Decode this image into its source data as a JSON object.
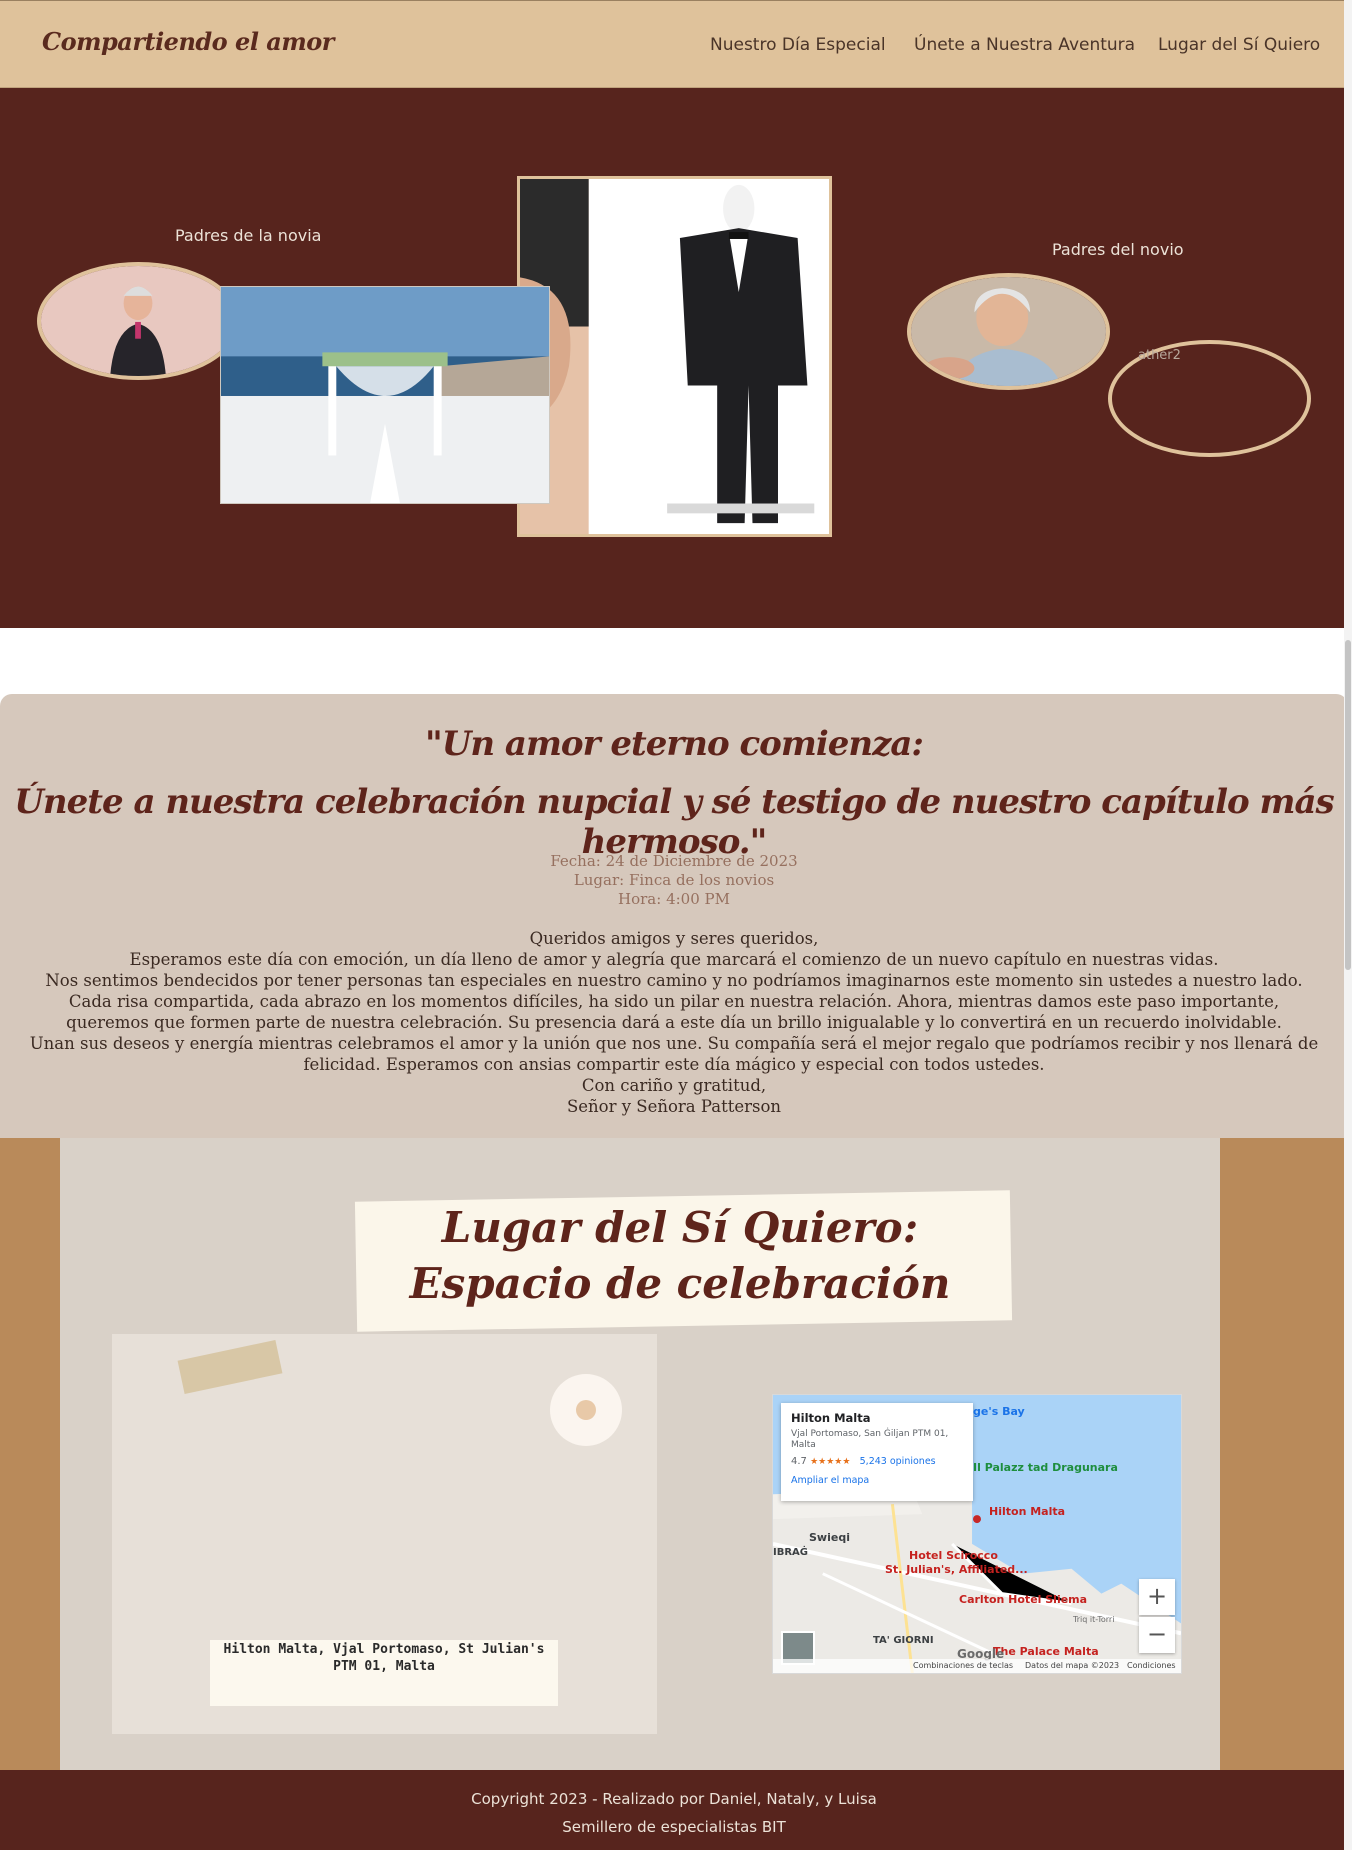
{
  "nav": {
    "brand": "Compartiendo el amor",
    "links": [
      "Nuestro Día Especial",
      "Únete a Nuestra Aventura",
      "Lugar del Sí Quiero"
    ]
  },
  "hero": {
    "bride_parents_title": "Padres de la novia",
    "groom_parents_title": "Padres del novio",
    "broken_image_alt": "ather2"
  },
  "invitation": {
    "quote_line1": "\"Un amor eterno comienza:",
    "quote_line2": "Únete a nuestra celebración nupcial y sé testigo de nuestro capítulo más hermoso.\"",
    "date": "Fecha: 24 de Diciembre de 2023",
    "place": "Lugar: Finca de los novios",
    "time": "Hora: 4:00 PM",
    "greeting": "Queridos amigos y seres queridos,",
    "p1": "Esperamos este día con emoción, un día lleno de amor y alegría que marcará el comienzo de un nuevo capítulo en nuestras vidas.",
    "p2": "Nos sentimos bendecidos por tener personas tan especiales en nuestro camino y no podríamos imaginarnos este momento sin ustedes a nuestro lado.",
    "p3": "Cada risa compartida, cada abrazo en los momentos difíciles, ha sido un pilar en nuestra relación. Ahora, mientras damos este paso importante, queremos que formen parte de nuestra celebración. Su presencia dará a este día un brillo inigualable y lo convertirá en un recuerdo inolvidable.",
    "p4": "Unan sus deseos y energía mientras celebramos el amor y la unión que nos une. Su compañía será el mejor regalo que podríamos recibir y nos llenará de felicidad. Esperamos con ansias compartir este día mágico y especial con todos ustedes.",
    "closing": "Con cariño y gratitud,",
    "signature": "Señor y Señora Patterson"
  },
  "venue": {
    "title": "Lugar del Sí Quiero: Espacio de celebración",
    "caption": "Hilton Malta, Vjal Portomaso, St Julian's PTM 01, Malta"
  },
  "map": {
    "place_name": "Hilton Malta",
    "address": "Vjal Portomaso, San Ġiljan PTM 01, Malta",
    "rating": "4.7",
    "stars": "★★★★★",
    "reviews": "5,243 opiniones",
    "enlarge_link": "Ampliar el mapa",
    "labels": {
      "bay": "ge's Bay",
      "palazz": "Il Palazz tad Dragunara",
      "hilton": "Hilton Malta",
      "swieqi": "Swieqi",
      "ibrag": "IBRAĠ",
      "scirocco1": "Hotel Scirocco",
      "scirocco2": "St. Julian's, Affiliated...",
      "carlton": "Carlton Hotel Sliema",
      "giorni": "TA' GIORNI",
      "palace": "The Palace Malta",
      "road": "Triq it-Torri"
    },
    "google": "Google",
    "shortcuts": "Combinaciones de teclas",
    "map_data": "Datos del mapa ©2023",
    "terms": "Condiciones",
    "zoom_in": "+",
    "zoom_out": "−"
  },
  "footer": {
    "line1": "Copyright 2023 - Realizado por Daniel, Nataly, y Luisa",
    "line2": "Semillero de especialistas BIT"
  },
  "colors": {
    "nav_bg": "#dfc29b",
    "hero_bg": "#57241d",
    "invite_bg": "#d6c8bc",
    "accent": "#5e241b"
  }
}
